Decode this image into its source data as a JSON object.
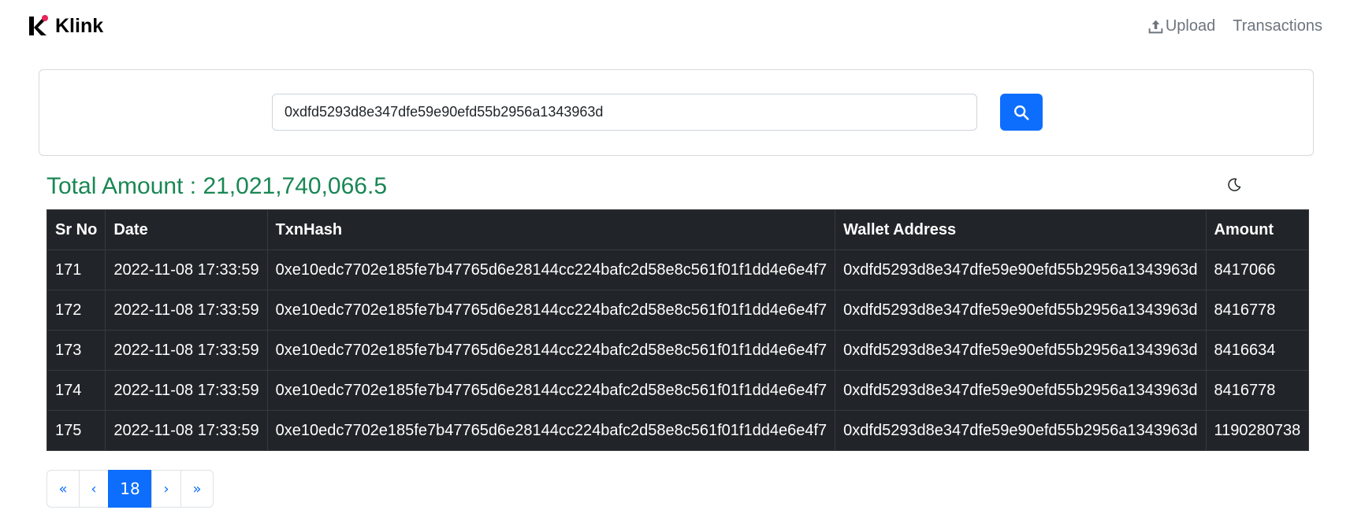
{
  "nav": {
    "brand": "Klink",
    "upload_label": "Upload",
    "transactions_label": "Transactions"
  },
  "search": {
    "value": "0xdfd5293d8e347dfe59e90efd55b2956a1343963d",
    "button_icon": "search-icon"
  },
  "summary": {
    "total_text": "Total Amount : 21,021,740,066.5",
    "theme_icon": "moon-icon"
  },
  "table": {
    "headers": [
      "Sr No",
      "Date",
      "TxnHash",
      "Wallet Address",
      "Amount"
    ],
    "rows": [
      [
        "171",
        "2022-11-08 17:33:59",
        "0xe10edc7702e185fe7b47765d6e28144cc224bafc2d58e8c561f01f1dd4e6e4f7",
        "0xdfd5293d8e347dfe59e90efd55b2956a1343963d",
        "8417066"
      ],
      [
        "172",
        "2022-11-08 17:33:59",
        "0xe10edc7702e185fe7b47765d6e28144cc224bafc2d58e8c561f01f1dd4e6e4f7",
        "0xdfd5293d8e347dfe59e90efd55b2956a1343963d",
        "8416778"
      ],
      [
        "173",
        "2022-11-08 17:33:59",
        "0xe10edc7702e185fe7b47765d6e28144cc224bafc2d58e8c561f01f1dd4e6e4f7",
        "0xdfd5293d8e347dfe59e90efd55b2956a1343963d",
        "8416634"
      ],
      [
        "174",
        "2022-11-08 17:33:59",
        "0xe10edc7702e185fe7b47765d6e28144cc224bafc2d58e8c561f01f1dd4e6e4f7",
        "0xdfd5293d8e347dfe59e90efd55b2956a1343963d",
        "8416778"
      ],
      [
        "175",
        "2022-11-08 17:33:59",
        "0xe10edc7702e185fe7b47765d6e28144cc224bafc2d58e8c561f01f1dd4e6e4f7",
        "0xdfd5293d8e347dfe59e90efd55b2956a1343963d",
        "1190280738"
      ]
    ]
  },
  "pagination": {
    "first": "«",
    "prev": "‹",
    "current": "18",
    "next": "›",
    "last": "»"
  },
  "colors": {
    "accent": "#0d6efd",
    "total_text": "#198754",
    "table_bg": "#212529"
  }
}
